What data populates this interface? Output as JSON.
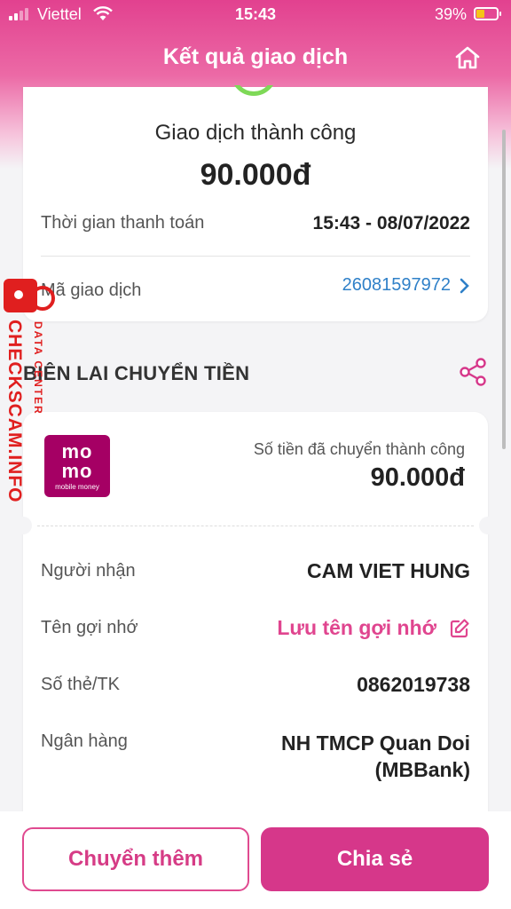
{
  "status_bar": {
    "carrier": "Viettel",
    "time": "15:43",
    "battery": "39%",
    "battery_level": 0.39
  },
  "header": {
    "title": "Kết quả giao dịch",
    "home_icon": "home-icon"
  },
  "summary": {
    "status": "Giao dịch thành công",
    "amount": "90.000đ",
    "payment_time_label": "Thời gian thanh toán",
    "payment_time_value": "15:43 - 08/07/2022",
    "transaction_id_label": "Mã giao dịch",
    "transaction_id_value": "26081597972"
  },
  "receipt": {
    "section_title": "BIÊN LAI CHUYỂN TIỀN",
    "share_icon": "share-icon",
    "logo": {
      "line1": "mo",
      "line2": "mo",
      "tagline": "mobile money"
    },
    "sent_label": "Số tiền đã chuyển thành công",
    "sent_amount": "90.000đ",
    "recipient_label": "Người nhận",
    "recipient_value": "CAM VIET HUNG",
    "nickname_label": "Tên gợi nhớ",
    "nickname_action": "Lưu tên gợi nhớ",
    "account_label": "Số thẻ/TK",
    "account_value": "0862019738",
    "bank_label": "Ngân hàng",
    "bank_value_line1": "NH TMCP Quan Doi",
    "bank_value_line2": "(MBBank)"
  },
  "watermark": {
    "main": "CHECKSCAM.INFO",
    "sub": "DATA CENTER"
  },
  "actions": {
    "transfer_more": "Chuyển thêm",
    "share": "Chia sẻ"
  },
  "colors": {
    "brand_pink": "#d6378a",
    "link_blue": "#2f80c8",
    "success_green": "#7ed957",
    "momo_purple": "#a50064",
    "watermark_red": "#e01f1f"
  }
}
